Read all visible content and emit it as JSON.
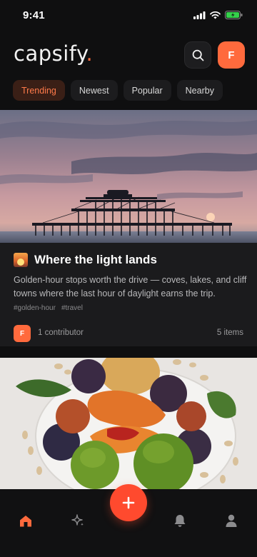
{
  "status_bar": {
    "time": "9:41"
  },
  "header": {
    "logo_text": "capsify",
    "logo_dot": ".",
    "avatar_initial": "F"
  },
  "filters": [
    {
      "label": "Trending",
      "active": true
    },
    {
      "label": "Newest",
      "active": false
    },
    {
      "label": "Popular",
      "active": false
    },
    {
      "label": "Nearby",
      "active": false
    }
  ],
  "card1": {
    "title": "Where the light lands",
    "description": "Golden-hour stops worth the drive — coves, lakes, and cliff towns where the last hour of daylight earns the trip.",
    "tags": [
      "#golden-hour",
      "#travel"
    ],
    "contributor_initial": "F",
    "contributors": "1 contributor",
    "items": "5 items"
  },
  "nav": {
    "items": [
      "home-icon",
      "sparkle-icon",
      "plus-icon",
      "bell-icon",
      "user-icon"
    ]
  },
  "colors": {
    "accent": "#ff6a3d",
    "fab": "#ff4a2e",
    "background": "#0f0f10",
    "card": "#1b1b1d"
  }
}
